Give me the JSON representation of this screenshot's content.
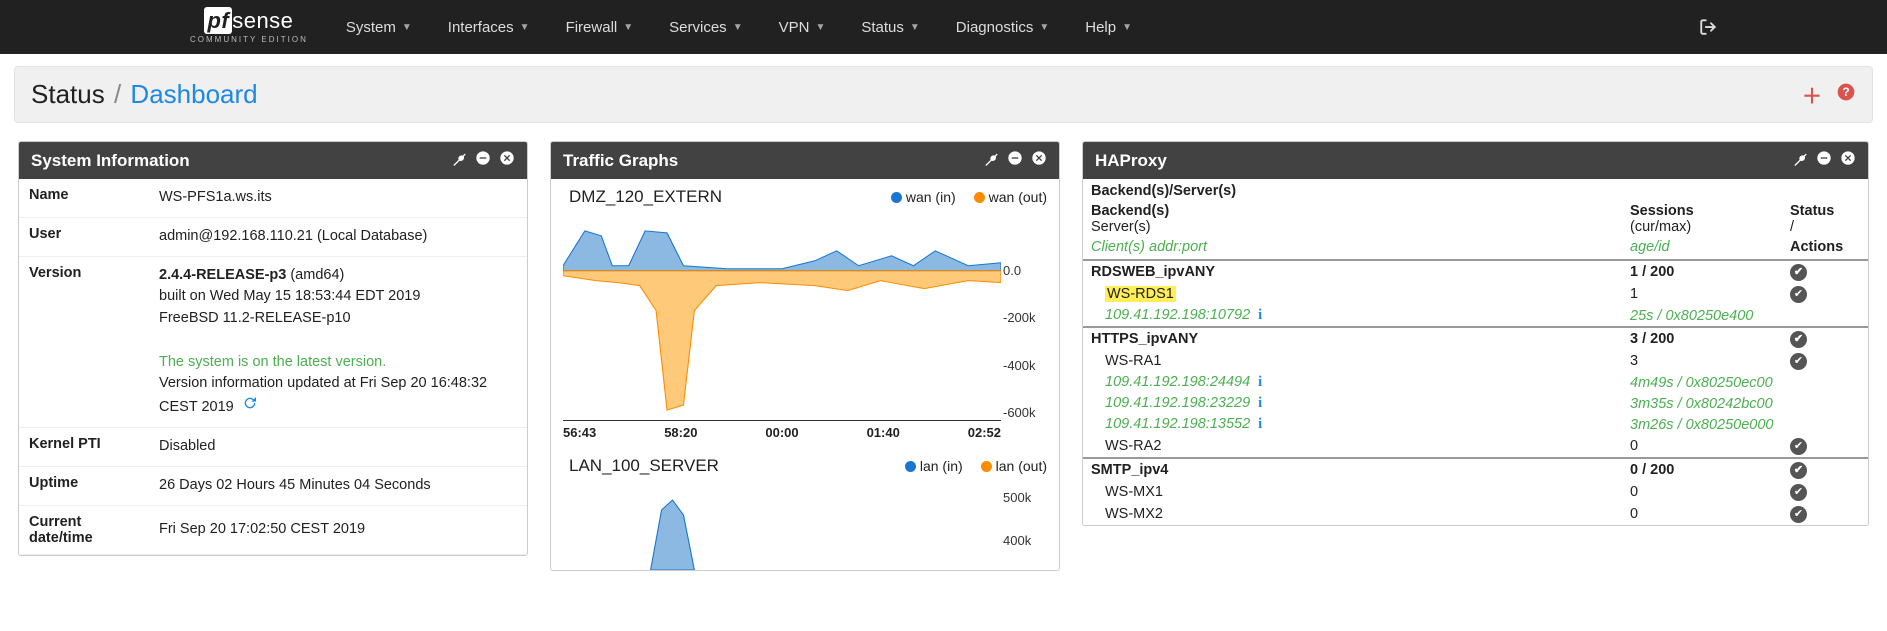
{
  "brand": {
    "pf": "pf",
    "sense": "sense",
    "sub": "COMMUNITY EDITION"
  },
  "nav": [
    "System",
    "Interfaces",
    "Firewall",
    "Services",
    "VPN",
    "Status",
    "Diagnostics",
    "Help"
  ],
  "breadcrumb": {
    "root": "Status",
    "current": "Dashboard"
  },
  "sysinfo": {
    "title": "System Information",
    "rows": {
      "name_label": "Name",
      "name_value": "WS-PFS1a.ws.its",
      "user_label": "User",
      "user_value": "admin@192.168.110.21 (Local Database)",
      "version_label": "Version",
      "version_line1": "2.4.4-RELEASE-p3",
      "version_arch": " (amd64)",
      "version_line2": "built on Wed May 15 18:53:44 EDT 2019",
      "version_line3": "FreeBSD 11.2-RELEASE-p10",
      "version_latest": "The system is on the latest version.",
      "version_updated": "Version information updated at Fri Sep 20 16:48:32 CEST 2019",
      "pti_label": "Kernel PTI",
      "pti_value": "Disabled",
      "uptime_label": "Uptime",
      "uptime_value": "26 Days 02 Hours 45 Minutes 04 Seconds",
      "datetime_label": "Current date/time",
      "datetime_value": "Fri Sep 20 17:02:50 CEST 2019"
    }
  },
  "traffic": {
    "title": "Traffic Graphs",
    "graphs": [
      {
        "name": "DMZ_120_EXTERN",
        "legend_in": "wan (in)",
        "legend_out": "wan (out)",
        "y_ticks": [
          "0.0",
          "-200k",
          "-400k",
          "-600k"
        ],
        "x_ticks": [
          "56:43",
          "58:20",
          "00:00",
          "01:40",
          "02:52"
        ]
      },
      {
        "name": "LAN_100_SERVER",
        "legend_in": "lan (in)",
        "legend_out": "lan (out)",
        "y_ticks": [
          "500k",
          "400k"
        ]
      }
    ]
  },
  "haproxy": {
    "title": "HAProxy",
    "header": {
      "backends_servers": "Backend(s)/Server(s)",
      "backends": "Backend(s)",
      "sessions": "Sessions",
      "status": "Status",
      "servers": "Server(s)",
      "curmax": "(cur/max)",
      "slash": "/",
      "client_addr": "Client(s) addr:port",
      "ageid": "age/id",
      "actions": "Actions"
    },
    "backends_list": [
      {
        "name": "RDSWEB_ipvANY",
        "sessions": "1 / 200",
        "status": "ok",
        "servers": [
          {
            "name": "WS-RDS1",
            "highlight": true,
            "sessions": "1",
            "status": "ok",
            "clients": [
              {
                "addr": "109.41.192.198:10792",
                "age": "25s / 0x80250e400"
              }
            ]
          }
        ]
      },
      {
        "name": "HTTPS_ipvANY",
        "sessions": "3 / 200",
        "status": "ok",
        "servers": [
          {
            "name": "WS-RA1",
            "sessions": "3",
            "status": "ok",
            "clients": [
              {
                "addr": "109.41.192.198:24494",
                "age": "4m49s / 0x80250ec00"
              },
              {
                "addr": "109.41.192.198:23229",
                "age": "3m35s / 0x80242bc00"
              },
              {
                "addr": "109.41.192.198:13552",
                "age": "3m26s / 0x80250e000"
              }
            ]
          },
          {
            "name": "WS-RA2",
            "sessions": "0",
            "status": "ok"
          }
        ]
      },
      {
        "name": "SMTP_ipv4",
        "sessions": "0 / 200",
        "status": "ok",
        "servers": [
          {
            "name": "WS-MX1",
            "sessions": "0",
            "status": "ok"
          },
          {
            "name": "WS-MX2",
            "sessions": "0",
            "status": "ok"
          }
        ]
      }
    ]
  }
}
